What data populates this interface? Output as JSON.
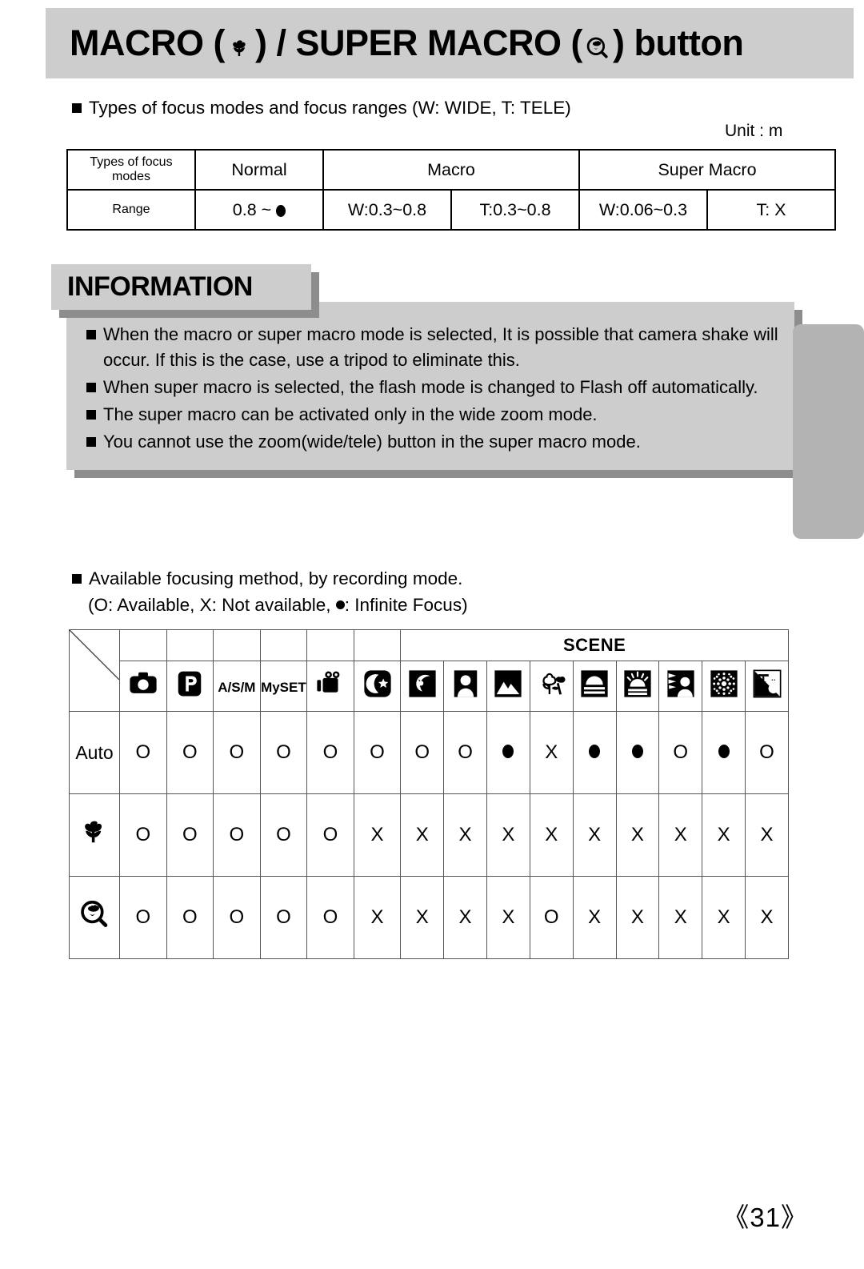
{
  "header": {
    "title_part1": "MACRO (",
    "title_icon1": "macro-tulip-icon",
    "title_part2": ") / SUPER MACRO (",
    "title_icon2": "super-macro-magnifier-icon",
    "title_part3": ") button"
  },
  "section1": {
    "heading": "Types of focus modes and focus ranges (W: WIDE, T: TELE)",
    "unit_label": "Unit : m"
  },
  "focus_table": {
    "header": {
      "corner": "Types of focus modes",
      "normal": "Normal",
      "macro": "Macro",
      "super_macro": "Super Macro"
    },
    "row_label": "Range",
    "values": {
      "normal": "0.8 ~ ",
      "normal_suffix_icon": "infinity-dot",
      "macro_w": "W:0.3~0.8",
      "macro_t": "T:0.3~0.8",
      "super_w": "W:0.06~0.3",
      "super_t": "T: X"
    }
  },
  "information": {
    "label": "INFORMATION",
    "items": [
      "When the macro or super macro mode is selected, It is possible that camera shake will occur. If this is the case, use a tripod to eliminate this.",
      "When super macro is selected, the flash mode is changed to Flash off automatically.",
      "The super macro can be activated only in the wide zoom mode.",
      "You cannot use the zoom(wide/tele) button in the super macro mode."
    ]
  },
  "section2": {
    "heading": "Available focusing method, by recording mode.",
    "legend_pre": "(O: Available, X: Not available, ",
    "legend_post": ": Infinite Focus)"
  },
  "availability_table": {
    "scene_group_label": "SCENE",
    "columns": [
      {
        "id": "auto",
        "type": "icon",
        "label": "camera-auto-icon",
        "group": "mode"
      },
      {
        "id": "program",
        "type": "icon",
        "label": "program-p-icon",
        "group": "mode"
      },
      {
        "id": "asm",
        "type": "text",
        "label": "A/S/M",
        "group": "mode"
      },
      {
        "id": "myset",
        "type": "text",
        "label": "MySET",
        "group": "mode"
      },
      {
        "id": "movie",
        "type": "icon",
        "label": "movie-camera-icon",
        "group": "mode"
      },
      {
        "id": "night",
        "type": "icon",
        "label": "night-moon-star-icon",
        "group": "mode"
      },
      {
        "id": "scene-night",
        "type": "icon",
        "label": "scene-night-icon",
        "group": "scene"
      },
      {
        "id": "portrait",
        "type": "icon",
        "label": "portrait-person-icon",
        "group": "scene"
      },
      {
        "id": "landscape",
        "type": "icon",
        "label": "landscape-mountain-icon",
        "group": "scene"
      },
      {
        "id": "closeup",
        "type": "icon",
        "label": "closeup-flower-icon",
        "group": "scene"
      },
      {
        "id": "sunset",
        "type": "icon",
        "label": "sunset-icon",
        "group": "scene"
      },
      {
        "id": "dawn",
        "type": "icon",
        "label": "dawn-sunrise-icon",
        "group": "scene"
      },
      {
        "id": "backlight",
        "type": "icon",
        "label": "backlight-icon",
        "group": "scene"
      },
      {
        "id": "fireworks",
        "type": "icon",
        "label": "fireworks-icon",
        "group": "scene"
      },
      {
        "id": "beachsnow",
        "type": "icon",
        "label": "beach-snow-icon",
        "group": "scene"
      }
    ],
    "rows": [
      {
        "id": "auto-focus",
        "label_type": "text",
        "label": "Auto",
        "cells": [
          "O",
          "O",
          "O",
          "O",
          "O",
          "O",
          "O",
          "O",
          "DOT",
          "X",
          "DOT",
          "DOT",
          "O",
          "DOT",
          "O"
        ]
      },
      {
        "id": "macro",
        "label_type": "icon",
        "label": "macro-tulip-icon",
        "cells": [
          "O",
          "O",
          "O",
          "O",
          "O",
          "X",
          "X",
          "X",
          "X",
          "X",
          "X",
          "X",
          "X",
          "X",
          "X"
        ]
      },
      {
        "id": "super-macro",
        "label_type": "icon",
        "label": "super-macro-magnifier-icon",
        "cells": [
          "O",
          "O",
          "O",
          "O",
          "O",
          "X",
          "X",
          "X",
          "X",
          "O",
          "X",
          "X",
          "X",
          "X",
          "X"
        ]
      }
    ]
  },
  "footer": {
    "page_number": "《31》"
  },
  "colors": {
    "banner_gray": "#cdcdcd",
    "shadow_gray": "#8d8d8d",
    "tab_gray": "#b3b3b3",
    "ink": "#000000"
  }
}
